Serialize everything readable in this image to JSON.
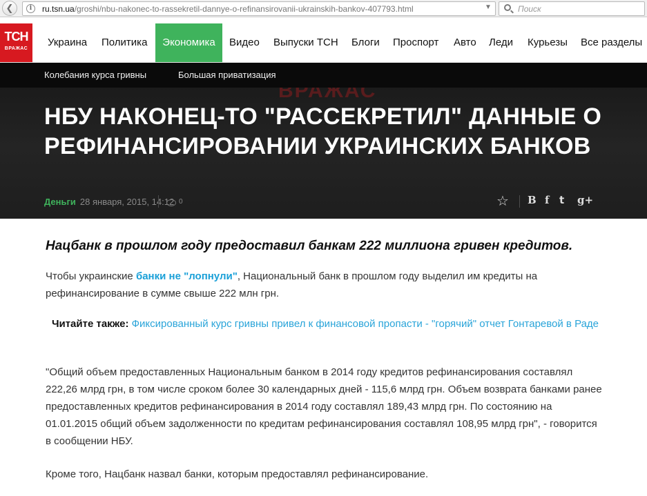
{
  "browser": {
    "url_host": "ru.tsn.ua",
    "url_path": "/groshi/nbu-nakonec-to-rassekretil-dannye-o-refinansirovanii-ukrainskih-bankov-407793.html",
    "search_placeholder": "Поиск",
    "back_glyph": "❮",
    "info_glyph": "i",
    "dropdown_glyph": "▼",
    "reload_glyph": "↻"
  },
  "logo": {
    "main": "ТСН",
    "sub": "ВРАЖАС"
  },
  "nav": {
    "items": [
      {
        "label": "Украина"
      },
      {
        "label": "Политика"
      },
      {
        "label": "Экономика",
        "active": true
      },
      {
        "label": "Видео"
      },
      {
        "label": "Выпуски ТСН"
      },
      {
        "label": "Блоги"
      },
      {
        "label": "Проспорт"
      },
      {
        "label": "Авто"
      },
      {
        "label": "Леди"
      },
      {
        "label": "Курьезы"
      },
      {
        "label": "Все разделы"
      }
    ]
  },
  "subnav": {
    "items": [
      {
        "label": "Колебания курса гривны"
      },
      {
        "label": "Большая приватизация"
      }
    ]
  },
  "article": {
    "watermark": "ВРАЖАС",
    "headline": "НБУ НАКОНЕЦ-ТО \"РАССЕКРЕТИЛ\" ДАННЫЕ О РЕФИНАНСИРОВАНИИ УКРАИНСКИХ БАНКОВ",
    "rubric": "Деньги",
    "date": "28 января, 2015, 14:12",
    "comments_count": "0",
    "lead": "Нацбанк в прошлом году предоставил банкам 222 миллиона гривен кредитов.",
    "p1_before": "Чтобы украинские ",
    "p1_link": "банки не \"лопнули\"",
    "p1_after": ", Национальный банк в прошлом году выделил им кредиты на рефинансирование в сумме свыше 222 млн грн.",
    "read_also_label": "Читайте также:",
    "read_also_link": "Фиксированный курс гривны привел к финансовой пропасти - \"горячий\" отчет Гонтаревой в Раде",
    "p2": "\"Общий объем предоставленных Национальным банком в 2014 году кредитов рефинансирования составлял 222,26 млрд грн, в том числе сроком более 30 календарных дней - 115,6 млрд грн. Объем возврата банками ранее предоставленных кредитов рефинансирования в 2014 году составлял 189,43 млрд грн. По состоянию на 01.01.2015 общий объем задолженности по кредитам рефинансирования составлял 108,95 млрд грн\", - говорится в сообщении НБУ.",
    "p3": "Кроме того, Нацбанк назвал банки, которым предоставлял рефинансирование."
  },
  "share": {
    "star": "☆",
    "vk": "В",
    "facebook": "f",
    "twitter": "t",
    "gplus": "g+"
  }
}
